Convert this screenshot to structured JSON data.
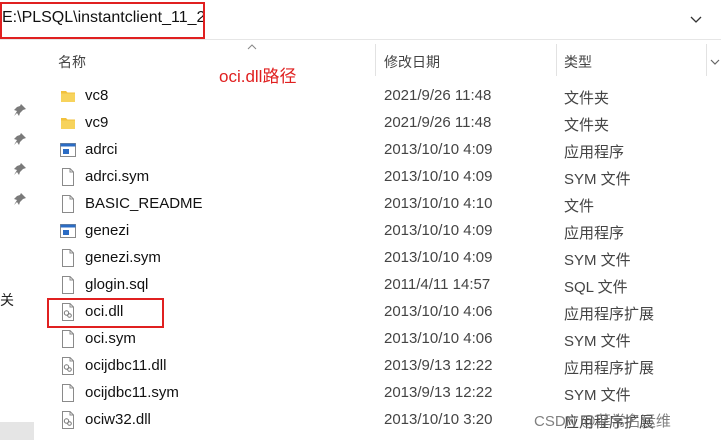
{
  "address": {
    "path": "E:\\PLSQL\\instantclient_11_2",
    "chevron_icon": "chevron-down-icon"
  },
  "sidebar": {
    "pins": [
      "pin-icon",
      "pin-icon",
      "pin-icon",
      "pin-icon"
    ],
    "partial_label": "关"
  },
  "columns": {
    "name": "名称",
    "date": "修改日期",
    "type": "类型"
  },
  "annotation": "oci.dll路径",
  "files": [
    {
      "name": "vc8",
      "date": "2021/9/26 11:48",
      "type": "文件夹",
      "icon": "folder-icon"
    },
    {
      "name": "vc9",
      "date": "2021/9/26 11:48",
      "type": "文件夹",
      "icon": "folder-icon"
    },
    {
      "name": "adrci",
      "date": "2013/10/10 4:09",
      "type": "应用程序",
      "icon": "app-icon"
    },
    {
      "name": "adrci.sym",
      "date": "2013/10/10 4:09",
      "type": "SYM 文件",
      "icon": "file-icon"
    },
    {
      "name": "BASIC_README",
      "date": "2013/10/10 4:10",
      "type": "文件",
      "icon": "file-icon"
    },
    {
      "name": "genezi",
      "date": "2013/10/10 4:09",
      "type": "应用程序",
      "icon": "app-icon"
    },
    {
      "name": "genezi.sym",
      "date": "2013/10/10 4:09",
      "type": "SYM 文件",
      "icon": "file-icon"
    },
    {
      "name": "glogin.sql",
      "date": "2011/4/11 14:57",
      "type": "SQL 文件",
      "icon": "file-icon"
    },
    {
      "name": "oci.dll",
      "date": "2013/10/10 4:06",
      "type": "应用程序扩展",
      "icon": "dll-icon"
    },
    {
      "name": "oci.sym",
      "date": "2013/10/10 4:06",
      "type": "SYM 文件",
      "icon": "file-icon"
    },
    {
      "name": "ocijdbc11.dll",
      "date": "2013/9/13 12:22",
      "type": "应用程序扩展",
      "icon": "dll-icon"
    },
    {
      "name": "ocijdbc11.sym",
      "date": "2013/9/13 12:22",
      "type": "SYM 文件",
      "icon": "file-icon"
    },
    {
      "name": "ociw32.dll",
      "date": "2013/10/10 3:20",
      "type": "应用程序扩展",
      "icon": "dll-icon"
    }
  ],
  "watermark": "CSDN @菲常名运维",
  "colors": {
    "highlight": "#e02020",
    "folder": "#f2c13c",
    "app_accent": "#2b6cc4"
  }
}
